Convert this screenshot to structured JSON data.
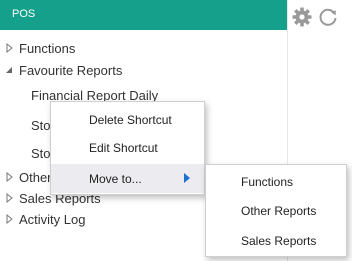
{
  "header": {
    "title": "POS"
  },
  "toolbar": {
    "settings_icon": "gear-icon",
    "refresh_icon": "refresh-icon"
  },
  "colors": {
    "header_bg": "#14a08a",
    "menu_selected_bg": "#ebebf0",
    "submenu_arrow": "#1f6fd1"
  },
  "tree": {
    "items": [
      {
        "label": "Functions",
        "expanded": false
      },
      {
        "label": "Favourite Reports",
        "expanded": true
      },
      {
        "label": "Financial Report Daily"
      },
      {
        "label": "Stoc"
      },
      {
        "label": "Stoc"
      },
      {
        "label": "Other"
      },
      {
        "label": "Sales Reports",
        "expanded": false
      },
      {
        "label": "Activity Log",
        "expanded": false
      }
    ]
  },
  "context_menu": {
    "items": [
      {
        "label": "Delete Shortcut"
      },
      {
        "label": "Edit Shortcut"
      },
      {
        "label": "Move to...",
        "has_submenu": true
      }
    ]
  },
  "submenu": {
    "items": [
      {
        "label": "Functions"
      },
      {
        "label": "Other Reports"
      },
      {
        "label": "Sales Reports"
      }
    ]
  }
}
